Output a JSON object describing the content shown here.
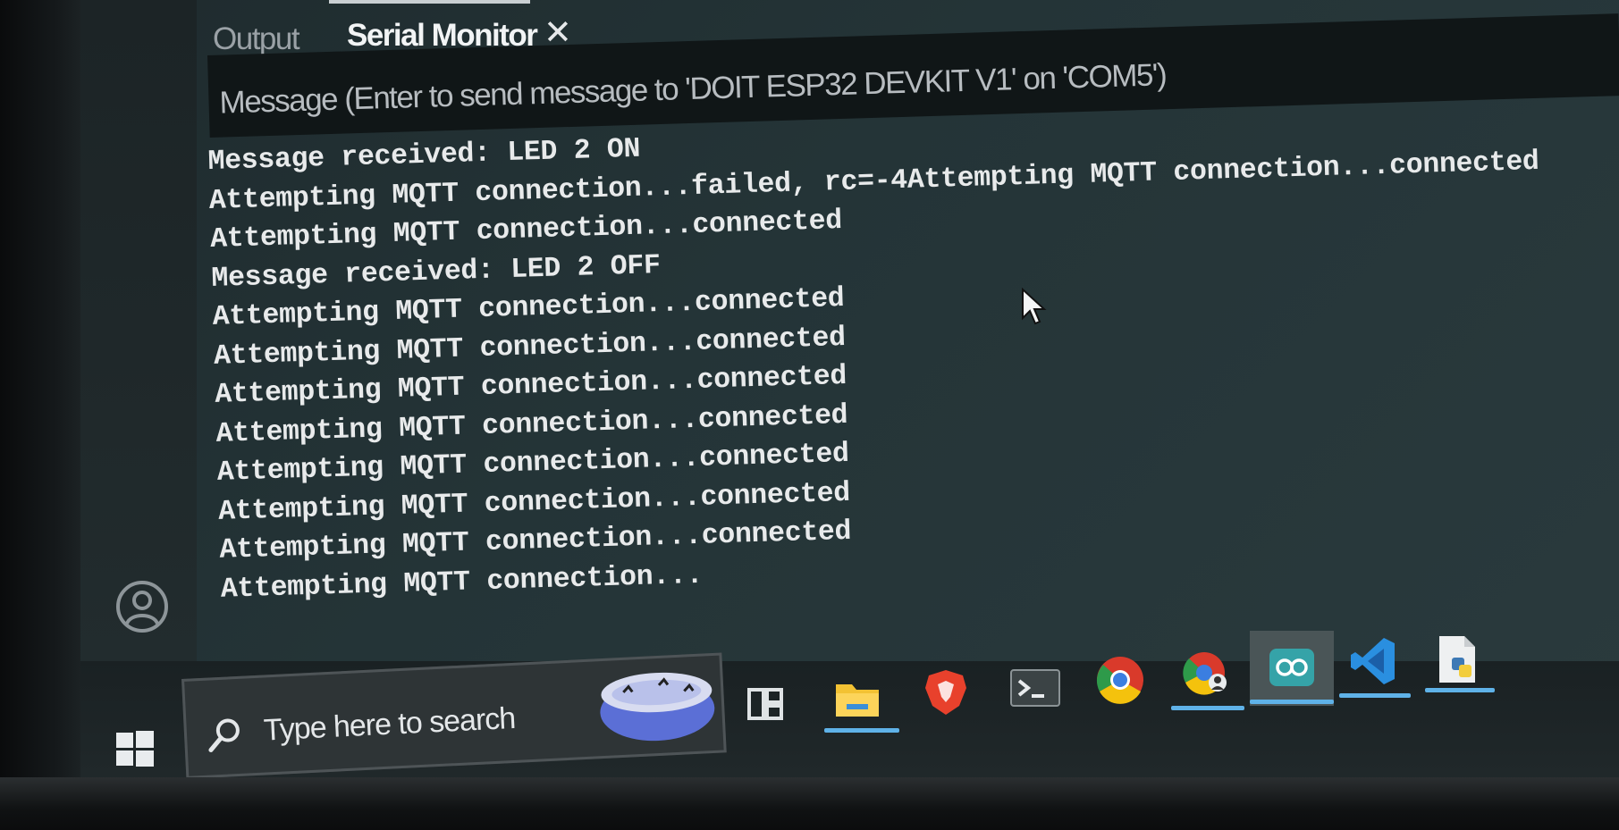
{
  "panel": {
    "tabs": [
      {
        "label": "Output",
        "active": false
      },
      {
        "label": "Serial Monitor",
        "active": true
      }
    ],
    "close_glyph": "✕"
  },
  "serial_monitor": {
    "message_placeholder": "Message (Enter to send message to 'DOIT ESP32 DEVKIT V1' on 'COM5')",
    "log_lines": [
      "Message received: LED 2 ON",
      "Attempting MQTT connection...failed, rc=-4Attempting MQTT connection...connected",
      "Attempting MQTT connection...connected",
      "Message received: LED 2 OFF",
      "Attempting MQTT connection...connected",
      "Attempting MQTT connection...connected",
      "Attempting MQTT connection...connected",
      "Attempting MQTT connection...connected",
      "Attempting MQTT connection...connected",
      "Attempting MQTT connection...connected",
      "Attempting MQTT connection...connected",
      "Attempting MQTT connection..."
    ]
  },
  "sidebar": {
    "account_icon": "account-icon"
  },
  "taskbar": {
    "search_placeholder": "Type here to search",
    "apps": [
      {
        "name": "task-view-icon",
        "running": false
      },
      {
        "name": "file-explorer-icon",
        "running": true
      },
      {
        "name": "brave-browser-icon",
        "running": false
      },
      {
        "name": "terminal-icon",
        "running": false
      },
      {
        "name": "chrome-icon",
        "running": false
      },
      {
        "name": "chrome-profile-icon",
        "running": true
      },
      {
        "name": "arduino-ide-icon",
        "running": true,
        "active": true
      },
      {
        "name": "vscode-icon",
        "running": true
      },
      {
        "name": "python-file-icon",
        "running": true
      }
    ]
  },
  "colors": {
    "editor_bg": "#243437",
    "log_text": "#e8eaeb",
    "taskbar_indicator": "#5fb2e8",
    "arduino_teal": "#35a3a8",
    "vscode_blue": "#2a8fe0"
  }
}
